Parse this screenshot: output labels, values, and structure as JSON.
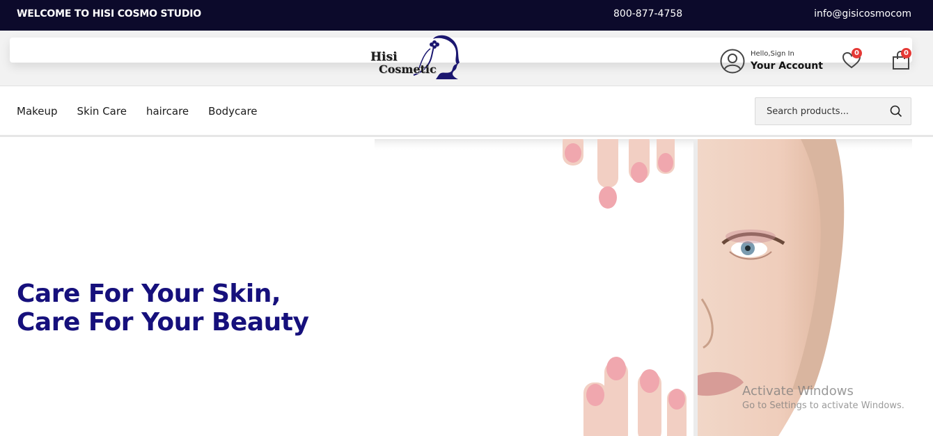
{
  "topbar": {
    "welcome": "WELCOME TO HISI COSMO STUDIO",
    "phone": "800-877-4758",
    "email": "info@gisicosmocom"
  },
  "header": {
    "logo_line1": "Hisi",
    "logo_line2": "Cosmetic",
    "account_greeting": "Hello,Sign In",
    "account_label": "Your Account",
    "wishlist_count": "0",
    "cart_count": "0",
    "icons": [
      "user-circle-icon",
      "heart-icon",
      "shopping-bag-icon"
    ]
  },
  "nav": {
    "items": [
      "Makeup",
      "Skin Care",
      "haircare",
      "Bodycare"
    ],
    "search_placeholder": "Search products..."
  },
  "hero": {
    "headline": "Care For Your Skin, Care For Your Beauty"
  },
  "watermark": {
    "line1": "Activate Windows",
    "line2": "Go to Settings to activate Windows."
  },
  "colors": {
    "topbar_bg": "#0c0a2b",
    "headline": "#16107c",
    "badge": "#e53935"
  }
}
